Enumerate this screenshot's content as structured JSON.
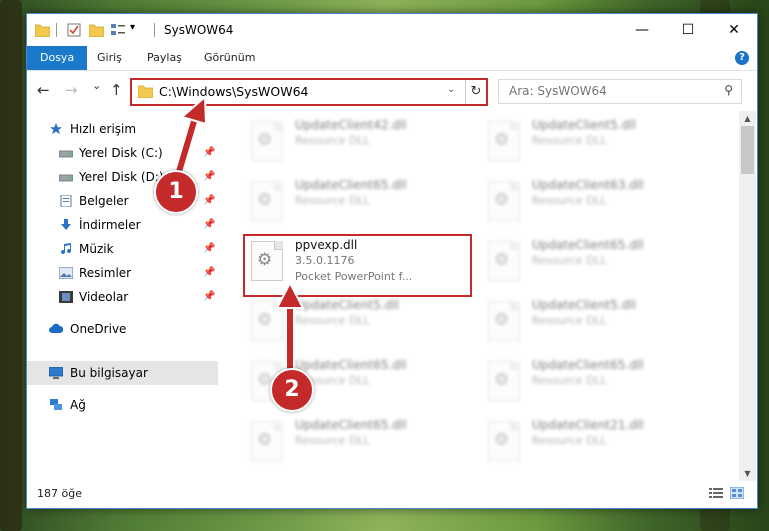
{
  "titlebar": {
    "title": "SysWOW64",
    "minimize": "—",
    "maximize": "☐",
    "close": "✕"
  },
  "ribbon": {
    "tabs": [
      {
        "label": "Dosya",
        "active": true
      },
      {
        "label": "Giriş"
      },
      {
        "label": "Paylaş"
      },
      {
        "label": "Görünüm"
      }
    ],
    "help": "?"
  },
  "nav": {
    "back": "←",
    "forward": "→",
    "recent": "⌄",
    "up": "↑",
    "address": "C:\\Windows\\SysWOW64",
    "address_dropdown": "⌄",
    "refresh": "↻",
    "search_placeholder": "Ara: SysWOW64",
    "search_icon": "⚲"
  },
  "sidebar": {
    "items": [
      {
        "label": "Hızlı erişim",
        "icon": "star-icon"
      },
      {
        "label": "Yerel Disk (C:)",
        "icon": "drive-icon",
        "pinned": true
      },
      {
        "label": "Yerel Disk (D:)",
        "icon": "drive-icon",
        "pinned": true
      },
      {
        "label": "Belgeler",
        "icon": "documents-icon",
        "pinned": true
      },
      {
        "label": "İndirmeler",
        "icon": "downloads-icon",
        "pinned": true
      },
      {
        "label": "Müzik",
        "icon": "music-icon",
        "pinned": true
      },
      {
        "label": "Resimler",
        "icon": "pictures-icon",
        "pinned": true
      },
      {
        "label": "Videolar",
        "icon": "videos-icon",
        "pinned": true
      },
      {
        "label": "OneDrive",
        "icon": "cloud-icon"
      },
      {
        "label": "Bu bilgisayar",
        "icon": "computer-icon",
        "selected": true
      },
      {
        "label": "Ağ",
        "icon": "network-icon"
      }
    ],
    "pin_glyph": "📌"
  },
  "files": {
    "left": [
      {
        "name": "UpdateClient42.dll",
        "desc": "Resource DLL"
      },
      {
        "name": "UpdateClient65.dll",
        "desc": "Resource DLL"
      },
      {
        "name": "ppvexp.dll",
        "version": "3.5.0.1176",
        "desc": "Pocket PowerPoint f...",
        "highlighted": true
      },
      {
        "name": "UpdateClient5.dll",
        "desc": "Resource DLL"
      },
      {
        "name": "UpdateClient65.dll",
        "desc": "Resource DLL"
      },
      {
        "name": "UpdateClient65.dll",
        "desc": "Resource DLL"
      }
    ],
    "right": [
      {
        "name": "UpdateClient5.dll",
        "desc": "Resource DLL"
      },
      {
        "name": "UpdateClient63.dll",
        "desc": "Resource DLL"
      },
      {
        "name": "UpdateClient65.dll",
        "desc": "Resource DLL"
      },
      {
        "name": "UpdateClient5.dll",
        "desc": "Resource DLL"
      },
      {
        "name": "UpdateClient65.dll",
        "desc": "Resource DLL"
      },
      {
        "name": "UpdateClient21.dll",
        "desc": "Resource DLL"
      }
    ]
  },
  "scrollbar": {
    "up": "▲",
    "down": "▼"
  },
  "status": {
    "count": "187 öğe"
  },
  "annotations": {
    "badge1": "1",
    "badge2": "2",
    "color": "#c42a2a"
  }
}
